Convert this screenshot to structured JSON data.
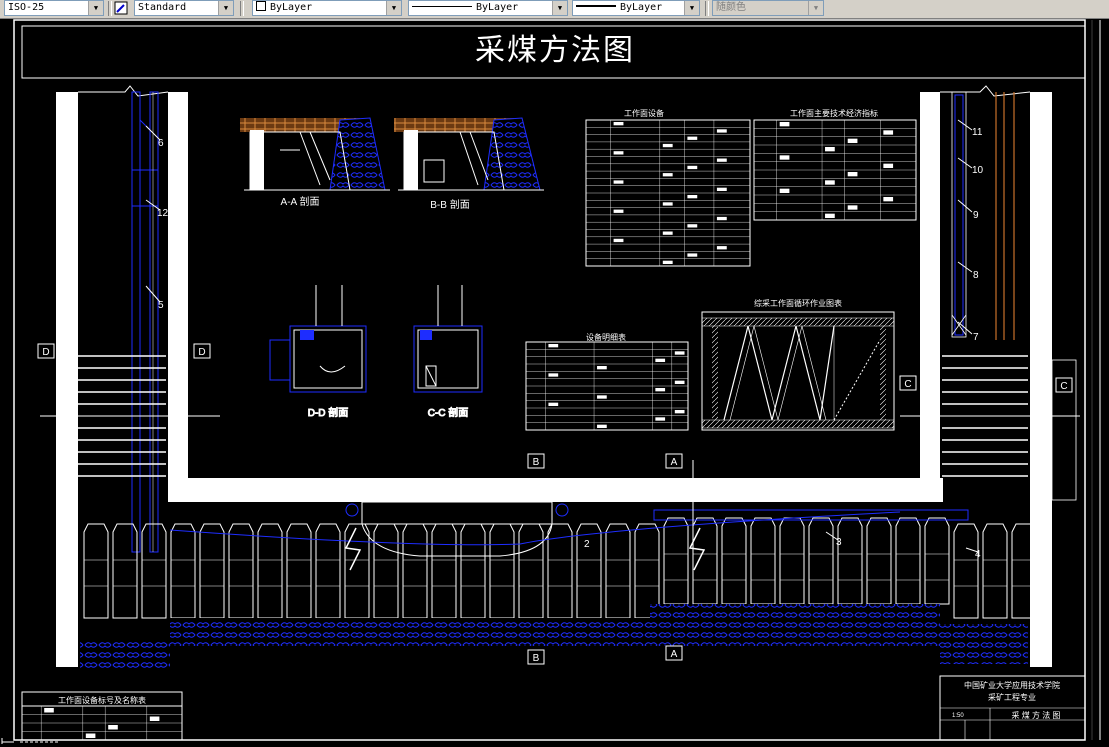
{
  "toolbar": {
    "dimstyle": "ISO-25",
    "textstyle": "Standard",
    "layer_color": "ByLayer",
    "linetype": "ByLayer",
    "lineweight": "ByLayer",
    "plotstyle": "随颜色"
  },
  "drawing": {
    "title": "采煤方法图",
    "section_labels": {
      "aa": "A-A 剖面",
      "bb": "B-B 剖面",
      "dd": "D-D 剖面",
      "cc": "C-C 剖面"
    },
    "tables": {
      "t1": "工作面设备",
      "t2": "工作面主要技术经济指标",
      "t3": "设备明细表",
      "t4": "综采工作面循环作业图表",
      "t5": "工作面设备标号及名称表"
    },
    "cut_marks": [
      "B",
      "A",
      "B",
      "A",
      "D",
      "D",
      "C",
      "C"
    ],
    "callouts": [
      "6",
      "12",
      "5",
      "11",
      "10",
      "9",
      "8",
      "7",
      "3",
      "4",
      "2"
    ],
    "title_block": {
      "org": "中国矿业大学应用技术学院",
      "major": "采矿工程专业",
      "name": "采 煤 方 法 图",
      "scale": "1:50"
    },
    "colors": {
      "white": "#ffffff",
      "blue": "#1e2dff",
      "brown": "#c8702a",
      "toolbar": "#d4d0c8"
    }
  }
}
